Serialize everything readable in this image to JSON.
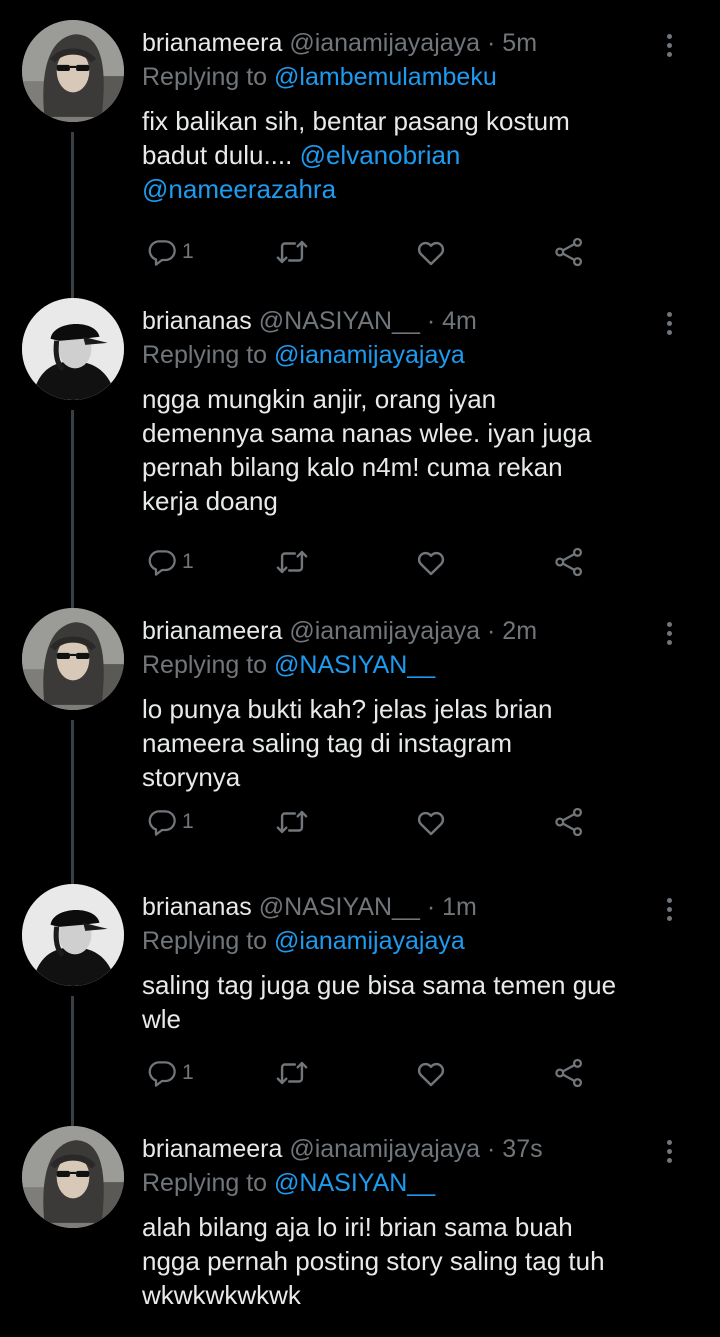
{
  "colors": {
    "background": "#000000",
    "text": "#e7e9ea",
    "secondary": "#71767b",
    "link": "#1d9bf0",
    "thread_line": "#3a3f44"
  },
  "replying_prefix": "Replying to",
  "tweets": [
    {
      "name": "brianameera",
      "handle": "@ianamijayajaya",
      "sep": "·",
      "time": "5m",
      "replying_to": "@lambemulambeku",
      "body_lines": [
        [
          {
            "t": "fix balikan sih, bentar pasang kostum"
          }
        ],
        [
          {
            "t": "badut dulu.... "
          },
          {
            "t": "@elvanobrian",
            "m": true
          }
        ],
        [
          {
            "t": "@nameerazahra",
            "m": true
          }
        ]
      ],
      "reply_count": "1",
      "avatar": "hood"
    },
    {
      "name": "briananas",
      "handle": "@NASIYAN__",
      "sep": "·",
      "time": "4m",
      "replying_to": "@ianamijayajaya",
      "body_lines": [
        [
          {
            "t": "ngga mungkin anjir, orang iyan"
          }
        ],
        [
          {
            "t": "demennya sama nanas wlee. iyan juga"
          }
        ],
        [
          {
            "t": "pernah bilang kalo n4m! cuma rekan"
          }
        ],
        [
          {
            "t": "kerja doang"
          }
        ]
      ],
      "reply_count": "1",
      "avatar": "cap"
    },
    {
      "name": "brianameera",
      "handle": "@ianamijayajaya",
      "sep": "·",
      "time": "2m",
      "replying_to": "@NASIYAN__",
      "body_lines": [
        [
          {
            "t": "lo punya bukti kah? jelas jelas brian"
          }
        ],
        [
          {
            "t": "nameera saling tag di instagram"
          }
        ],
        [
          {
            "t": "storynya"
          }
        ]
      ],
      "reply_count": "1",
      "avatar": "hood"
    },
    {
      "name": "briananas",
      "handle": "@NASIYAN__",
      "sep": "·",
      "time": "1m",
      "replying_to": "@ianamijayajaya",
      "body_lines": [
        [
          {
            "t": "saling tag juga gue bisa sama temen gue"
          }
        ],
        [
          {
            "t": "wle"
          }
        ]
      ],
      "reply_count": "1",
      "avatar": "cap"
    },
    {
      "name": "brianameera",
      "handle": "@ianamijayajaya",
      "sep": "·",
      "time": "37s",
      "replying_to": "@NASIYAN__",
      "body_lines": [
        [
          {
            "t": "alah bilang aja lo iri! brian sama buah"
          }
        ],
        [
          {
            "t": "ngga pernah posting story saling tag tuh"
          }
        ],
        [
          {
            "t": "wkwkwkwkwk"
          }
        ]
      ],
      "reply_count": "",
      "avatar": "hood"
    }
  ]
}
